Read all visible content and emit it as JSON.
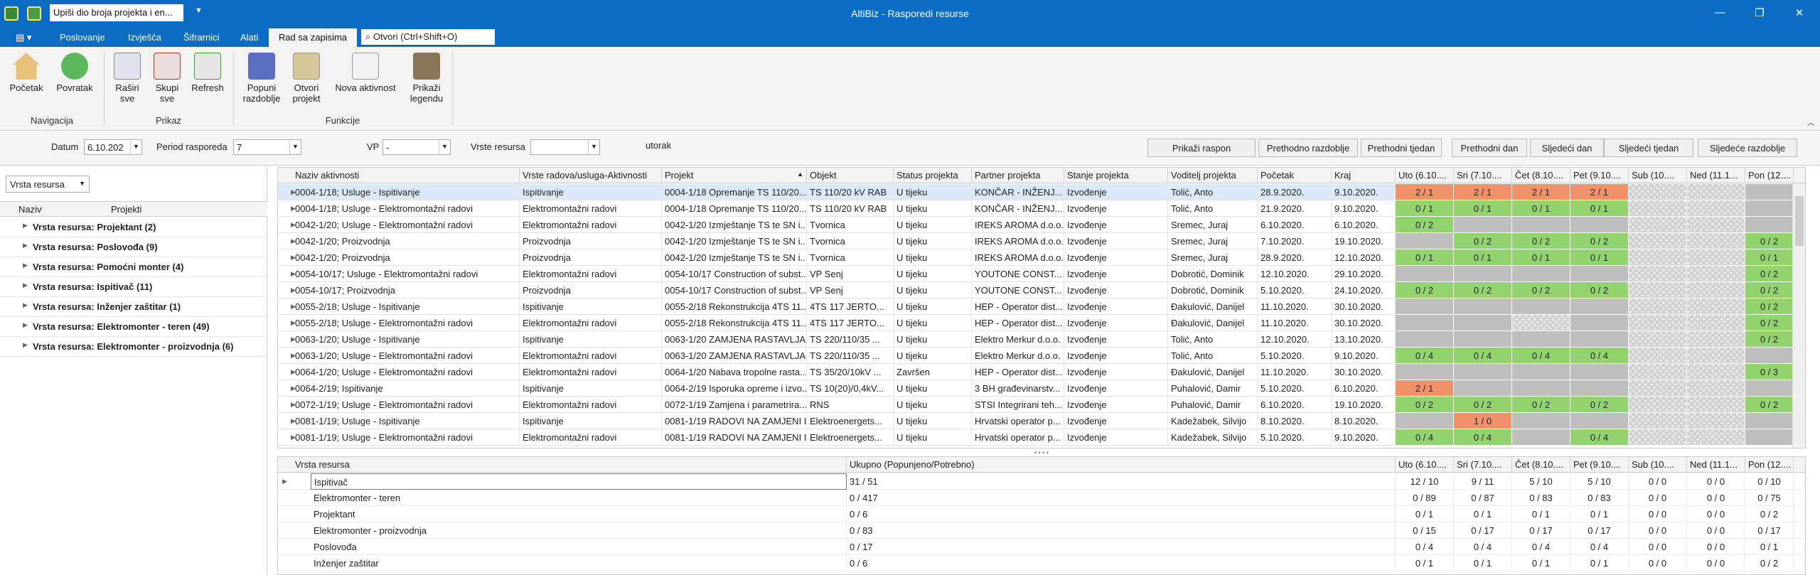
{
  "titlebar": {
    "search_value": "Upiši dio broja projekta i en...",
    "title": "AltiBiz - Rasporedi resurse",
    "minimize": "—",
    "restore": "❐",
    "close": "✕"
  },
  "menu": {
    "items": [
      "Poslovanje",
      "Izvješća",
      "Šifrarnici",
      "Alati"
    ],
    "active": "Rad sa zapisima",
    "open_placeholder": "Otvori (Ctrl+Shift+O)"
  },
  "ribbon": {
    "buttons": [
      {
        "label1": "Početak",
        "label2": "",
        "icon": "home-icon"
      },
      {
        "label1": "Povratak",
        "label2": "",
        "icon": "back-icon"
      },
      {
        "label1": "Raširi",
        "label2": "sve",
        "icon": "expand-all-icon"
      },
      {
        "label1": "Skupi",
        "label2": "sve",
        "icon": "collapse-all-icon"
      },
      {
        "label1": "Refresh",
        "label2": "",
        "icon": "refresh-icon"
      },
      {
        "label1": "Popuni",
        "label2": "razdoblje",
        "icon": "fill-period-icon"
      },
      {
        "label1": "Otvori",
        "label2": "projekt",
        "icon": "open-project-icon"
      },
      {
        "label1": "Nova aktivnost",
        "label2": "",
        "icon": "new-activity-icon"
      },
      {
        "label1": "Prikaži",
        "label2": "legendu",
        "icon": "legend-icon"
      }
    ],
    "groups": [
      "Navigacija",
      "Prikaz",
      "Funkcije"
    ]
  },
  "filters": {
    "datum_label": "Datum",
    "datum_value": "6.10.202",
    "period_label": "Period rasporeda",
    "period_value": "7",
    "vp_label": "VP",
    "vp_value": "-",
    "vrste_label": "Vrste resursa",
    "vrste_value": "",
    "day_name": "utorak",
    "nav_buttons": [
      "Prikaži raspon",
      "Prethodno razdoblje",
      "Prethodni tjedan",
      "Prethodni dan",
      "Sljedeći dan",
      "Sljedeći tjedan",
      "Sljedeće razdoblje"
    ]
  },
  "left_panel": {
    "combo": "Vrsta resursa",
    "headers": [
      "Naziv",
      "Projekti"
    ],
    "groups": [
      "Vrsta resursa: Projektant (2)",
      "Vrsta resursa: Poslovođa (9)",
      "Vrsta resursa: Pomoćni monter (4)",
      "Vrsta resursa: Ispitivač (11)",
      "Vrsta resursa: Inženjer zaštitar (1)",
      "Vrsta resursa: Elektromonter - teren (49)",
      "Vrsta resursa: Elektromonter - proizvodnja (6)"
    ]
  },
  "grid": {
    "headers": [
      "Naziv aktivnosti",
      "Vrste radova/usluga-Aktivnosti",
      "Projekt",
      "Objekt",
      "Status projekta",
      "Partner projekta",
      "Stanje projekta",
      "Voditelj projekta",
      "Početak",
      "Kraj",
      "Uto (6.10....",
      "Sri (7.10....",
      "Čet (8.10....",
      "Pet (9.10....",
      "Sub (10....",
      "Ned (11.1...",
      "Pon (12...."
    ],
    "sort_icon": "▲",
    "rows": [
      {
        "c": [
          "0004-1/18; Usluge - Ispitivanje",
          "Ispitivanje",
          "0004-1/18 Opremanje TS 110/20...",
          "TS 110/20 kV RAB",
          "U tijeku",
          "KONČAR - INŽENJ...",
          "Izvođenje",
          "Tolić, Anto",
          "28.9.2020.",
          "9.10.2020."
        ],
        "d": [
          "2 / 1",
          "2 / 1",
          "2 / 1",
          "2 / 1",
          "",
          "",
          ""
        ],
        "s": [
          "r",
          "r",
          "r",
          "r",
          "h",
          "h",
          "g"
        ]
      },
      {
        "c": [
          "0004-1/18; Usluge - Elektromontažni radovi",
          "Elektromontažni radovi",
          "0004-1/18 Opremanje TS 110/20...",
          "TS 110/20 kV RAB",
          "U tijeku",
          "KONČAR - INŽENJ...",
          "Izvođenje",
          "Tolić, Anto",
          "21.9.2020.",
          "9.10.2020."
        ],
        "d": [
          "0 / 1",
          "0 / 1",
          "0 / 1",
          "0 / 1",
          "",
          "",
          ""
        ],
        "s": [
          "G",
          "G",
          "G",
          "G",
          "h",
          "h",
          "g"
        ]
      },
      {
        "c": [
          "0042-1/20; Usluge - Elektromontažni radovi",
          "Elektromontažni radovi",
          "0042-1/20 Izmještanje TS te SN i...",
          "Tvornica",
          "U tijeku",
          "IREKS AROMA d.o.o.",
          "Izvođenje",
          "Sremec, Juraj",
          "6.10.2020.",
          "6.10.2020."
        ],
        "d": [
          "0 / 2",
          "",
          "",
          "",
          "",
          "",
          ""
        ],
        "s": [
          "G",
          "g",
          "g",
          "g",
          "h",
          "h",
          "g"
        ]
      },
      {
        "c": [
          "0042-1/20; Proizvodnja",
          "Proizvodnja",
          "0042-1/20 Izmještanje TS te SN i...",
          "Tvornica",
          "U tijeku",
          "IREKS AROMA d.o.o.",
          "Izvođenje",
          "Sremec, Juraj",
          "7.10.2020.",
          "19.10.2020."
        ],
        "d": [
          "",
          "0 / 2",
          "0 / 2",
          "0 / 2",
          "",
          "",
          "0 / 2"
        ],
        "s": [
          "g",
          "G",
          "G",
          "G",
          "h",
          "h",
          "G"
        ]
      },
      {
        "c": [
          "0042-1/20; Proizvodnja",
          "Proizvodnja",
          "0042-1/20 Izmještanje TS te SN i...",
          "Tvornica",
          "U tijeku",
          "IREKS AROMA d.o.o.",
          "Izvođenje",
          "Sremec, Juraj",
          "28.9.2020.",
          "12.10.2020."
        ],
        "d": [
          "0 / 1",
          "0 / 1",
          "0 / 1",
          "0 / 1",
          "",
          "",
          "0 / 1"
        ],
        "s": [
          "G",
          "G",
          "G",
          "G",
          "h",
          "h",
          "G"
        ]
      },
      {
        "c": [
          "0054-10/17; Usluge - Elektromontažni radovi",
          "Elektromontažni radovi",
          "0054-10/17 Construction of subst...",
          "VP Senj",
          "U tijeku",
          "YOUTONE CONST...",
          "Izvođenje",
          "Dobrotić, Dominik",
          "12.10.2020.",
          "29.10.2020."
        ],
        "d": [
          "",
          "",
          "",
          "",
          "",
          "",
          "0 / 2"
        ],
        "s": [
          "g",
          "g",
          "g",
          "g",
          "h",
          "h",
          "G"
        ]
      },
      {
        "c": [
          "0054-10/17; Proizvodnja",
          "Proizvodnja",
          "0054-10/17 Construction of subst...",
          "VP Senj",
          "U tijeku",
          "YOUTONE CONST...",
          "Izvođenje",
          "Dobrotić, Dominik",
          "5.10.2020.",
          "24.10.2020."
        ],
        "d": [
          "0 / 2",
          "0 / 2",
          "0 / 2",
          "0 / 2",
          "",
          "",
          "0 / 2"
        ],
        "s": [
          "G",
          "G",
          "G",
          "G",
          "h",
          "h",
          "G"
        ]
      },
      {
        "c": [
          "0055-2/18; Usluge - Ispitivanje",
          "Ispitivanje",
          "0055-2/18 Rekonstrukcija 4TS 11...",
          "4TS 117 JERTO...",
          "U tijeku",
          "HEP - Operator dist...",
          "Izvođenje",
          "Đakulović, Danijel",
          "11.10.2020.",
          "30.10.2020."
        ],
        "d": [
          "",
          "",
          "",
          "",
          "",
          "",
          "0 / 2"
        ],
        "s": [
          "g",
          "g",
          "g",
          "g",
          "h",
          "h",
          "G"
        ]
      },
      {
        "c": [
          "0055-2/18; Usluge - Elektromontažni radovi",
          "Elektromontažni radovi",
          "0055-2/18 Rekonstrukcija 4TS 11...",
          "4TS 117 JERTO...",
          "U tijeku",
          "HEP - Operator dist...",
          "Izvođenje",
          "Đakulović, Danijel",
          "11.10.2020.",
          "30.10.2020."
        ],
        "d": [
          "",
          "",
          "",
          "",
          "",
          "",
          "0 / 2"
        ],
        "s": [
          "g",
          "g",
          "h",
          "g",
          "h",
          "h",
          "G"
        ]
      },
      {
        "c": [
          "0063-1/20; Usluge - Ispitivanje",
          "Ispitivanje",
          "0063-1/20 ZAMJENA RASTAVLJA...",
          "TS 220/110/35 ...",
          "U tijeku",
          "Elektro Merkur d.o.o.",
          "Izvođenje",
          "Tolić, Anto",
          "12.10.2020.",
          "13.10.2020."
        ],
        "d": [
          "",
          "",
          "",
          "",
          "",
          "",
          "0 / 2"
        ],
        "s": [
          "g",
          "g",
          "g",
          "g",
          "h",
          "h",
          "G"
        ]
      },
      {
        "c": [
          "0063-1/20; Usluge - Elektromontažni radovi",
          "Elektromontažni radovi",
          "0063-1/20 ZAMJENA RASTAVLJA...",
          "TS 220/110/35 ...",
          "U tijeku",
          "Elektro Merkur d.o.o.",
          "Izvođenje",
          "Tolić, Anto",
          "5.10.2020.",
          "9.10.2020."
        ],
        "d": [
          "0 / 4",
          "0 / 4",
          "0 / 4",
          "0 / 4",
          "",
          "",
          ""
        ],
        "s": [
          "G",
          "G",
          "G",
          "G",
          "h",
          "h",
          "g"
        ]
      },
      {
        "c": [
          "0064-1/20; Usluge - Elektromontažni radovi",
          "Elektromontažni radovi",
          "0064-1/20 Nabava tropolne rasta...",
          "TS 35/20/10kV ...",
          "Završen",
          "HEP - Operator dist...",
          "Izvođenje",
          "Đakulović, Danijel",
          "11.10.2020.",
          "30.10.2020."
        ],
        "d": [
          "",
          "",
          "",
          "",
          "",
          "",
          "0 / 3"
        ],
        "s": [
          "g",
          "g",
          "g",
          "g",
          "h",
          "h",
          "G"
        ]
      },
      {
        "c": [
          "0064-2/19; Ispitivanje",
          "Ispitivanje",
          "0064-2/19 Isporuka opreme i izvo...",
          "TS 10(20)/0,4kV...",
          "U tijeku",
          "3 BH građevinarstv...",
          "Izvođenje",
          "Puhalović, Damir",
          "5.10.2020.",
          "6.10.2020."
        ],
        "d": [
          "2 / 1",
          "",
          "",
          "",
          "",
          "",
          ""
        ],
        "s": [
          "r",
          "g",
          "g",
          "g",
          "h",
          "h",
          "g"
        ]
      },
      {
        "c": [
          "0072-1/19; Usluge - Elektromontažni radovi",
          "Elektromontažni radovi",
          "0072-1/19 Zamjena i parametrira...",
          "RNS",
          "U tijeku",
          "STSI Integrirani teh...",
          "Izvođenje",
          "Puhalović, Damir",
          "6.10.2020.",
          "19.10.2020."
        ],
        "d": [
          "0 / 2",
          "0 / 2",
          "0 / 2",
          "0 / 2",
          "",
          "",
          "0 / 2"
        ],
        "s": [
          "G",
          "G",
          "G",
          "G",
          "h",
          "h",
          "G"
        ]
      },
      {
        "c": [
          "0081-1/19; Usluge - Ispitivanje",
          "Ispitivanje",
          "0081-1/19 RADOVI NA ZAMJENI I...",
          "Elektroenergets...",
          "U tijeku",
          "Hrvatski operator p...",
          "Izvođenje",
          "Kadežabek, Silvijo",
          "8.10.2020.",
          "8.10.2020."
        ],
        "d": [
          "",
          "1 / 0",
          "",
          "",
          "",
          "",
          ""
        ],
        "s": [
          "g",
          "r",
          "g",
          "g",
          "h",
          "h",
          "g"
        ]
      },
      {
        "c": [
          "0081-1/19; Usluge - Elektromontažni radovi",
          "Elektromontažni radovi",
          "0081-1/19 RADOVI NA ZAMJENI I...",
          "Elektroenergets...",
          "U tijeku",
          "Hrvatski operator p...",
          "Izvođenje",
          "Kadežabek, Silvijo",
          "5.10.2020.",
          "9.10.2020."
        ],
        "d": [
          "0 / 4",
          "0 / 4",
          "",
          "0 / 4",
          "",
          "",
          ""
        ],
        "s": [
          "G",
          "G",
          "g",
          "G",
          "h",
          "h",
          "g"
        ]
      }
    ]
  },
  "summary": {
    "headers": [
      "Vrsta resursa",
      "Ukupno (Popunjeno/Potrebno)",
      "Uto (6.10....",
      "Sri (7.10....",
      "Čet (8.10....",
      "Pet (9.10....",
      "Sub (10....",
      "Ned (11.1...",
      "Pon (12...."
    ],
    "rows": [
      [
        "Ispitivač",
        "31 / 51",
        "12 / 10",
        "9 / 11",
        "5 / 10",
        "5 / 10",
        "0 / 0",
        "0 / 0",
        "0 / 10"
      ],
      [
        "Elektromonter - teren",
        "0 / 417",
        "0 / 89",
        "0 / 87",
        "0 / 83",
        "0 / 83",
        "0 / 0",
        "0 / 0",
        "0 / 75"
      ],
      [
        "Projektant",
        "0 / 6",
        "0 / 1",
        "0 / 1",
        "0 / 1",
        "0 / 1",
        "0 / 0",
        "0 / 0",
        "0 / 2"
      ],
      [
        "Elektromonter - proizvodnja",
        "0 / 83",
        "0 / 15",
        "0 / 17",
        "0 / 17",
        "0 / 17",
        "0 / 0",
        "0 / 0",
        "0 / 17"
      ],
      [
        "Poslovođa",
        "0 / 17",
        "0 / 4",
        "0 / 4",
        "0 / 4",
        "0 / 4",
        "0 / 0",
        "0 / 0",
        "0 / 1"
      ],
      [
        "Inženjer zaštitar",
        "0 / 6",
        "0 / 1",
        "0 / 1",
        "0 / 1",
        "0 / 1",
        "0 / 0",
        "0 / 0",
        "0 / 2"
      ]
    ]
  },
  "colors": {
    "accent": "#0b6cc4",
    "over": "#f0916a",
    "under": "#92d36e",
    "none": "#bebebe"
  }
}
